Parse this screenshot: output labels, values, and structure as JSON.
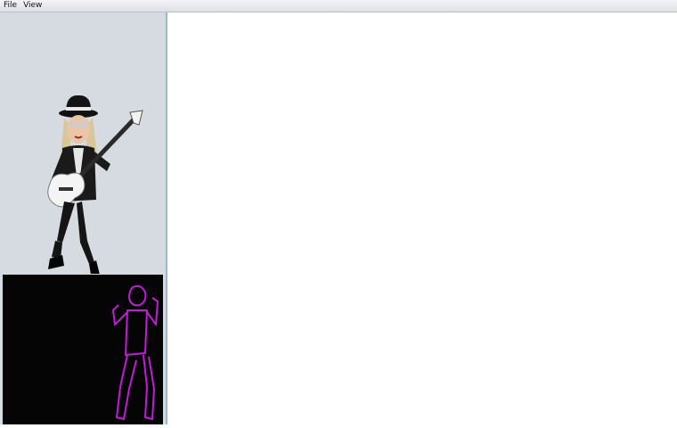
{
  "menubar": {
    "items": [
      {
        "label": "File"
      },
      {
        "label": "View"
      }
    ]
  },
  "sidebar": {
    "avatar_panel": {
      "icon": "guitarist-avatar-icon"
    },
    "skeleton_panel": {
      "icon": "skeleton-figure-icon",
      "stroke_color": "#c21ad8",
      "background": "#050505"
    }
  },
  "main": {
    "background": "#ffffff"
  }
}
